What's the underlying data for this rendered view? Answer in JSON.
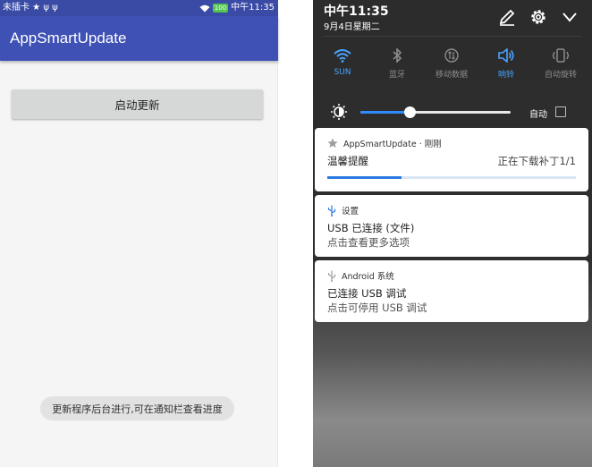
{
  "left": {
    "status_bar": {
      "carrier": "未插卡 ★ ψ ψ",
      "battery": "100",
      "time": "中午11:35"
    },
    "app_bar": {
      "title": "AppSmartUpdate"
    },
    "start_button": {
      "label": "启动更新"
    },
    "toast": {
      "text": "更新程序后台进行,可在通知栏查看进度"
    }
  },
  "right": {
    "header": {
      "time": "中午11:35",
      "date": "9月4日星期二"
    },
    "quick_settings": [
      {
        "label": "SUN",
        "icon": "wifi-icon",
        "on": true
      },
      {
        "label": "蓝牙",
        "icon": "bluetooth-icon",
        "on": false
      },
      {
        "label": "移动数据",
        "icon": "mobile-data-icon",
        "on": false
      },
      {
        "label": "响铃",
        "icon": "volume-icon",
        "on": true
      },
      {
        "label": "自动旋转",
        "icon": "auto-rotate-icon",
        "on": false
      }
    ],
    "brightness": {
      "auto_label": "自动",
      "level": 0.33
    },
    "notifications": [
      {
        "app": "AppSmartUpdate · 刚刚",
        "icon": "star-icon",
        "title": "温馨提醒",
        "progress_text": "正在下载补丁1/1",
        "progress": 0.3
      },
      {
        "app": "设置",
        "icon": "usb-icon",
        "title": "USB 已连接 (文件)",
        "text": "点击查看更多选项"
      },
      {
        "app": "Android 系统",
        "icon": "usb-icon",
        "title": "已连接 USB 调试",
        "text": "点击可停用 USB 调试"
      }
    ],
    "colors": {
      "accent": "#4aa3ff",
      "progress": "#2a7ae2",
      "app_bar": "#3f51b5"
    }
  }
}
